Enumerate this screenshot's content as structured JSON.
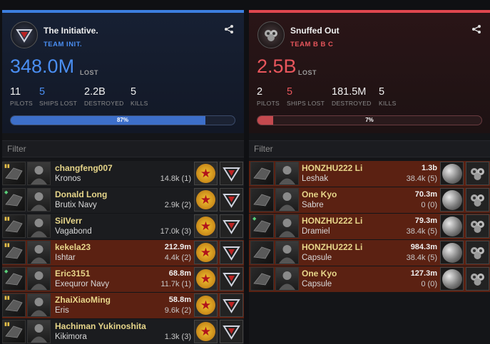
{
  "teams": [
    {
      "name": "The Initiative.",
      "tag": "TEAM INIT.",
      "lost_value": "348.0M",
      "lost_label": "LOST",
      "stats": [
        {
          "value": "11",
          "label": "PILOTS"
        },
        {
          "value": "5",
          "label": "SHIPS LOST"
        },
        {
          "value": "2.2B",
          "label": "DESTROYED"
        },
        {
          "value": "5",
          "label": "KILLS"
        }
      ],
      "efficiency": 0.87,
      "efficiency_label": "87%",
      "filter_placeholder": "Filter",
      "accent": "#4a8ef2",
      "rows": [
        {
          "pilot": "changfeng007",
          "ship": "Kronos",
          "value": "",
          "damage": "14.8k (1)",
          "lost": false,
          "flag": "yellow"
        },
        {
          "pilot": "Donald Long",
          "ship": "Brutix Navy",
          "value": "",
          "damage": "2.9k (2)",
          "lost": false,
          "flag": "green"
        },
        {
          "pilot": "SiIVerr",
          "ship": "Vagabond",
          "value": "",
          "damage": "17.0k (3)",
          "lost": false,
          "flag": "yellow"
        },
        {
          "pilot": "kekela23",
          "ship": "Ishtar",
          "value": "212.9m",
          "damage": "4.4k (2)",
          "lost": true,
          "flag": "yellow"
        },
        {
          "pilot": "Eric3151",
          "ship": "Exequror Navy",
          "value": "68.8m",
          "damage": "11.7k (1)",
          "lost": true,
          "flag": "green"
        },
        {
          "pilot": "ZhaiXiaoMing",
          "ship": "Eris",
          "value": "58.8m",
          "damage": "9.6k (2)",
          "lost": true,
          "flag": "yellow"
        },
        {
          "pilot": "Hachiman Yukinoshita",
          "ship": "Kikimora",
          "value": "",
          "damage": "1.3k (3)",
          "lost": false,
          "flag": "yellow"
        }
      ]
    },
    {
      "name": "Snuffed Out",
      "tag": "TEAM B B C",
      "lost_value": "2.5B",
      "lost_label": "LOST",
      "stats": [
        {
          "value": "2",
          "label": "PILOTS"
        },
        {
          "value": "5",
          "label": "SHIPS LOST"
        },
        {
          "value": "181.5M",
          "label": "DESTROYED"
        },
        {
          "value": "5",
          "label": "KILLS"
        }
      ],
      "efficiency": 0.07,
      "efficiency_label": "7%",
      "filter_placeholder": "Filter",
      "accent": "#e8565c",
      "rows": [
        {
          "pilot": "HONZHU222 Li",
          "ship": "Leshak",
          "value": "1.3b",
          "damage": "38.4k (5)",
          "lost": true,
          "flag": ""
        },
        {
          "pilot": "One Kyo",
          "ship": "Sabre",
          "value": "70.3m",
          "damage": "0 (0)",
          "lost": true,
          "flag": ""
        },
        {
          "pilot": "HONZHU222 Li",
          "ship": "Dramiel",
          "value": "79.3m",
          "damage": "38.4k (5)",
          "lost": true,
          "flag": "green"
        },
        {
          "pilot": "HONZHU222 Li",
          "ship": "Capsule",
          "value": "984.3m",
          "damage": "38.4k (5)",
          "lost": true,
          "flag": ""
        },
        {
          "pilot": "One Kyo",
          "ship": "Capsule",
          "value": "127.3m",
          "damage": "0 (0)",
          "lost": true,
          "flag": ""
        }
      ]
    }
  ],
  "icons": {
    "share": "share-icon",
    "corp_left": "red-star-corp-logo",
    "corp_right": "moon-corp-logo",
    "alliance": "triangle-alliance-logo"
  }
}
